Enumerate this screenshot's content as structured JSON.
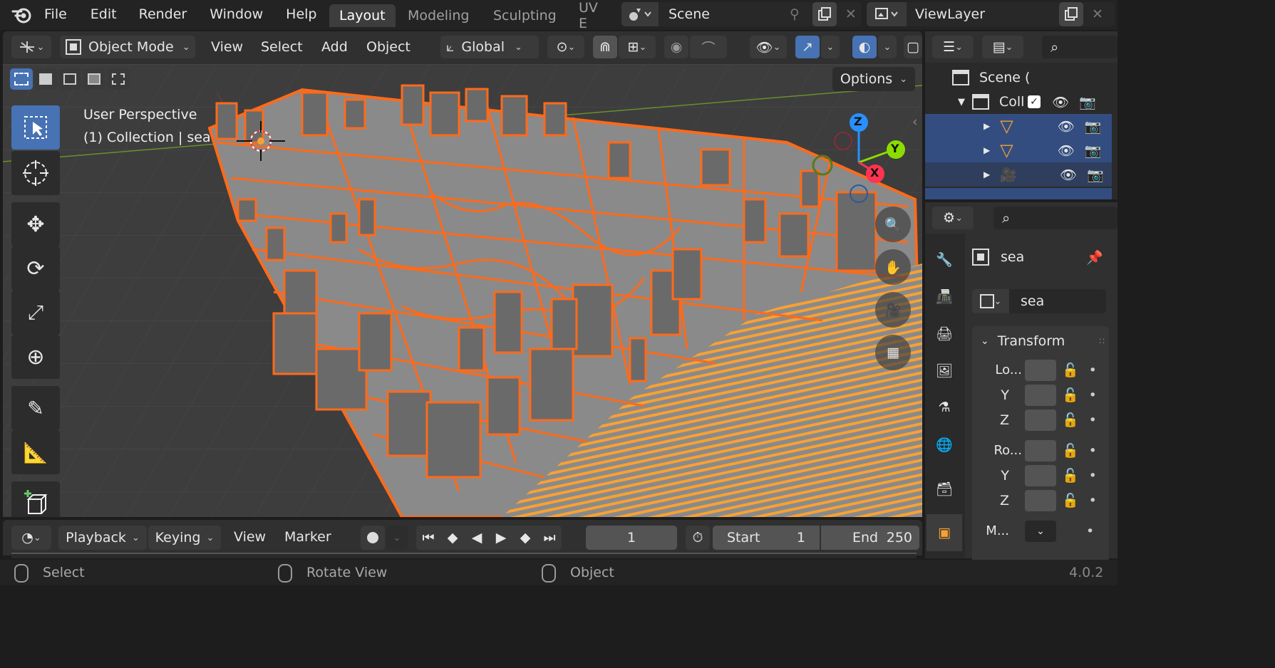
{
  "menu": [
    "File",
    "Edit",
    "Render",
    "Window",
    "Help"
  ],
  "workspace_tabs": [
    {
      "label": "Layout",
      "active": true
    },
    {
      "label": "Modeling",
      "active": false
    },
    {
      "label": "Sculpting",
      "active": false
    },
    {
      "label": "UV E",
      "active": false
    }
  ],
  "scene": {
    "name": "Scene"
  },
  "view_layer": {
    "name": "ViewLayer"
  },
  "viewport_header": {
    "mode": "Object Mode",
    "menus": [
      "View",
      "Select",
      "Add",
      "Object"
    ],
    "transform_orientation": "Global",
    "options_label": "Options"
  },
  "viewport": {
    "perspective_label": "User Perspective",
    "collection_label": "(1) Collection | sea",
    "gizmo_axes": {
      "z": "Z",
      "y": "Y",
      "x": "X"
    }
  },
  "outliner": {
    "scene_label": "Scene (",
    "collection_label": "Coll"
  },
  "properties": {
    "object_name": "sea",
    "data_name": "sea",
    "panel_title": "Transform",
    "location_label": "Lo...",
    "rotation_label": "Ro...",
    "axis_y": "Y",
    "axis_z": "Z",
    "mode_label": "M..."
  },
  "timeline": {
    "playback": "Playback",
    "keying": "Keying",
    "view": "View",
    "marker": "Marker",
    "current_frame": "1",
    "start_label": "Start",
    "start_value": "1",
    "end_label": "End",
    "end_value": "250"
  },
  "status": {
    "select": "Select",
    "rotate": "Rotate View",
    "object": "Object",
    "version": "4.0.2"
  },
  "colors": {
    "accent": "#4772b3",
    "selection_orange": "#ff6a1a",
    "active_orange": "#f7a134",
    "axis_x": "#ff3352",
    "axis_y": "#8bdc00",
    "axis_z": "#2890ff"
  }
}
